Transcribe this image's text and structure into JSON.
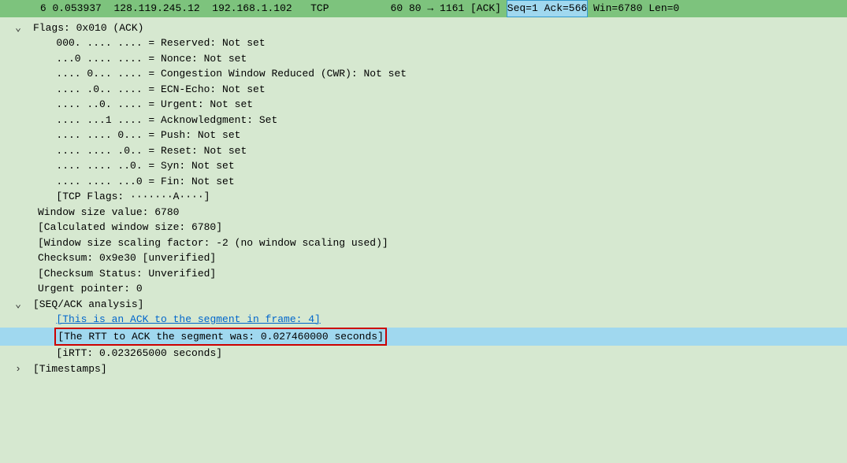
{
  "header": {
    "no": "6",
    "time": "0.053937",
    "src": "128.119.245.12",
    "dst": "192.168.1.102",
    "proto": "TCP",
    "len": "60",
    "info_pre": " 80 → 1161 [ACK] ",
    "seqack": "Seq=1 Ack=566",
    "info_post": " Win=6780 Len=0"
  },
  "tree": {
    "flags_header": "Flags: 0x010 (ACK)",
    "reserved": "   000. .... .... = Reserved: Not set",
    "nonce": "   ...0 .... .... = Nonce: Not set",
    "cwr": "   .... 0... .... = Congestion Window Reduced (CWR): Not set",
    "ecn": "   .... .0.. .... = ECN-Echo: Not set",
    "urgent": "   .... ..0. .... = Urgent: Not set",
    "ack": "   .... ...1 .... = Acknowledgment: Set",
    "push": "   .... .... 0... = Push: Not set",
    "reset": "   .... .... .0.. = Reset: Not set",
    "syn": "   .... .... ..0. = Syn: Not set",
    "fin": "   .... .... ...0 = Fin: Not set",
    "tcpflags": "   [TCP Flags: ·······A····]",
    "winsize": "Window size value: 6780",
    "calcwin": "[Calculated window size: 6780]",
    "scaling": "[Window size scaling factor: -2 (no window scaling used)]",
    "checksum": "Checksum: 0x9e30 [unverified]",
    "checksumstat": "[Checksum Status: Unverified]",
    "urgentptr": "Urgent pointer: 0",
    "seqack_header": "[SEQ/ACK analysis]",
    "ack_link": "[This is an ACK to the segment in frame: 4]",
    "rtt": "[The RTT to ACK the segment was: 0.027460000 seconds]",
    "irtt": "[iRTT: 0.023265000 seconds]",
    "timestamps": "[Timestamps]"
  }
}
